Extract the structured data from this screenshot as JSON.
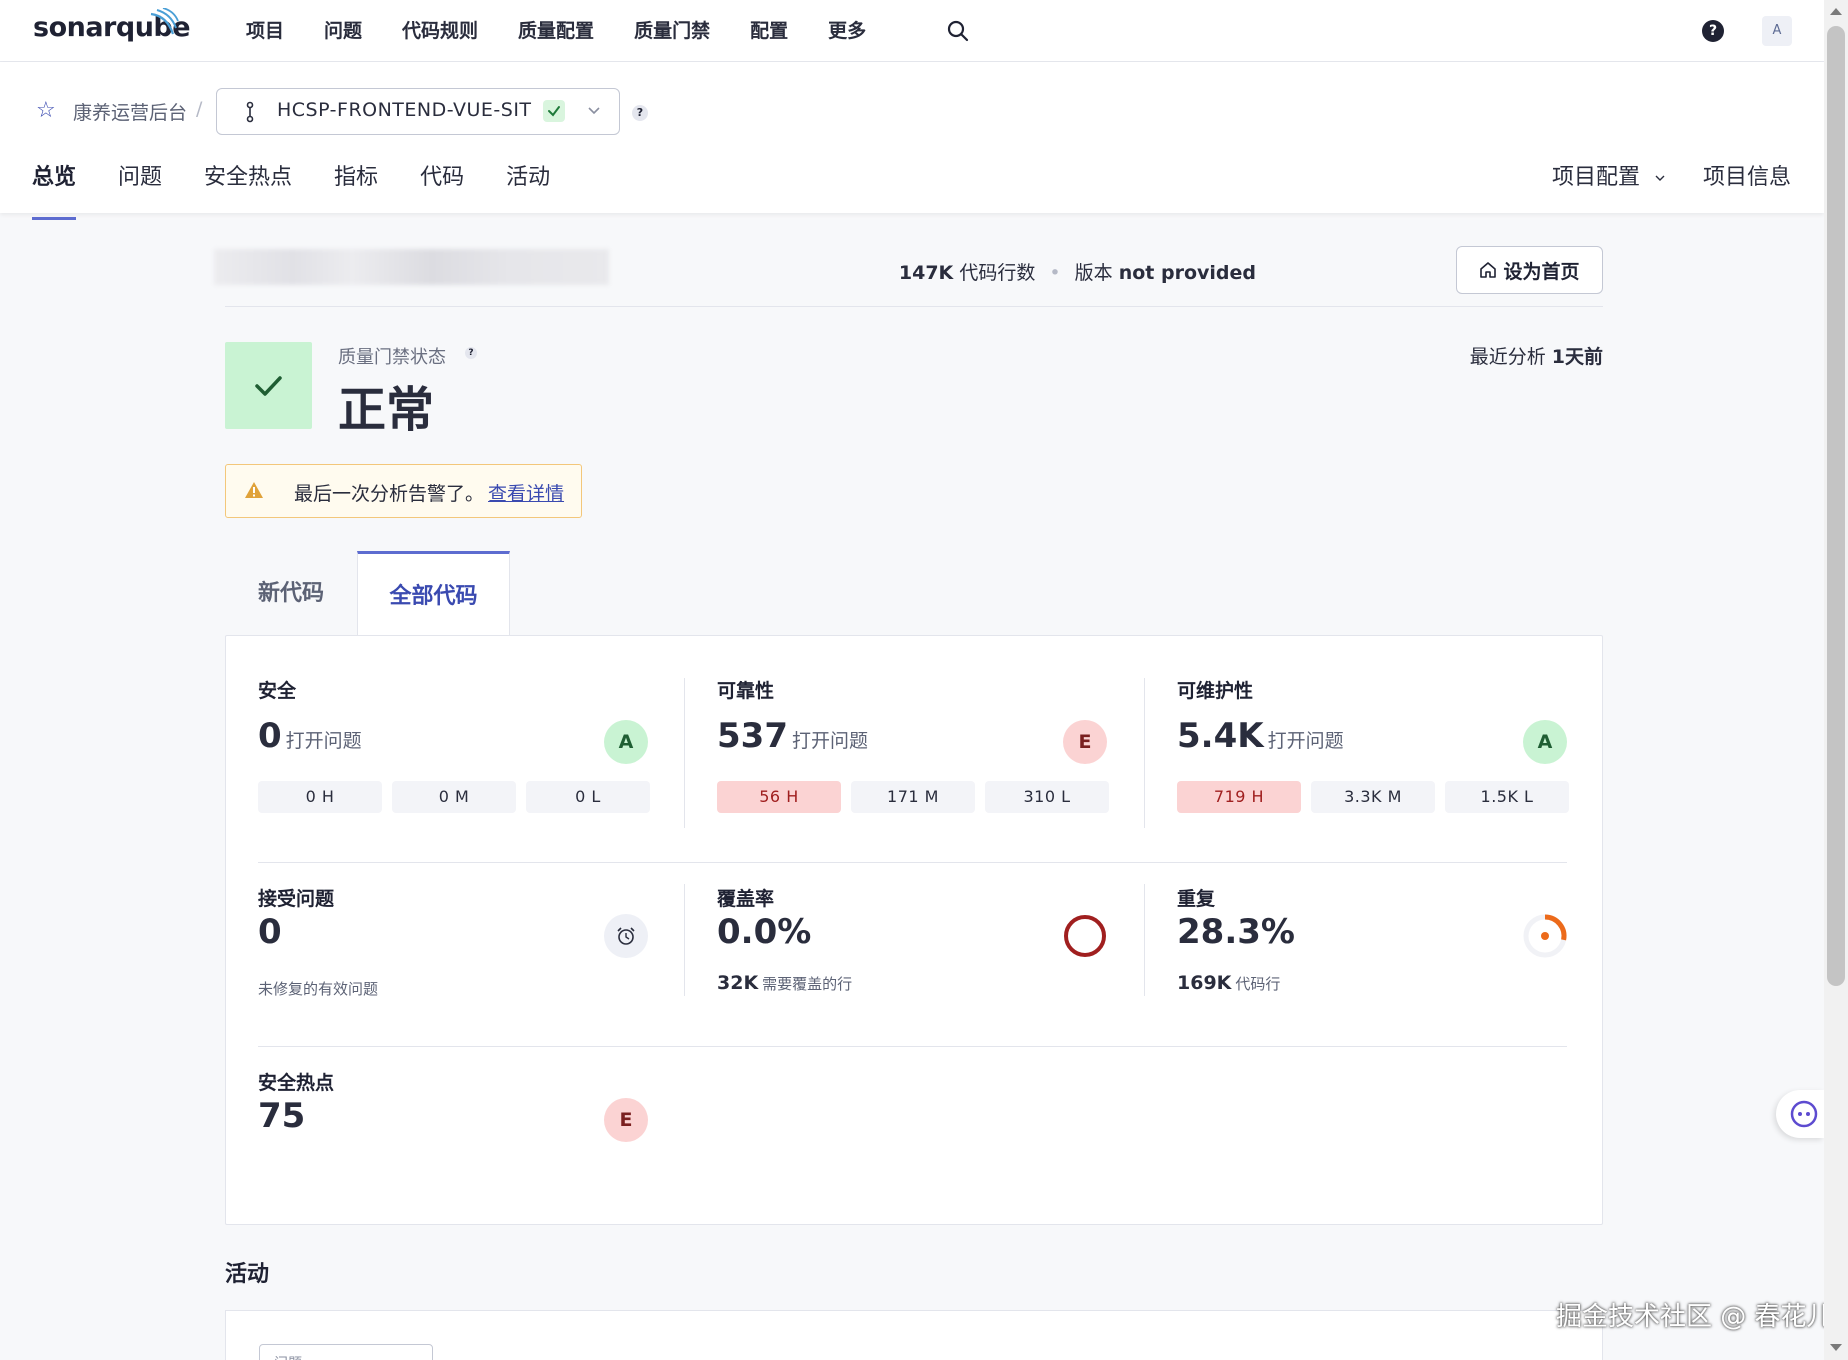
{
  "topnav": {
    "logo": "sonarqube",
    "items": [
      "项目",
      "问题",
      "代码规则",
      "质量配置",
      "质量门禁",
      "配置",
      "更多"
    ],
    "avatar": "A",
    "help": "?"
  },
  "project": {
    "org": "康养运营后台",
    "branch": "HCSP-FRONTEND-VUE-SIT",
    "tabs": [
      "总览",
      "问题",
      "安全热点",
      "指标",
      "代码",
      "活动"
    ],
    "right_tabs": {
      "config": "项目配置",
      "info": "项目信息"
    }
  },
  "meta": {
    "loc_value": "147K",
    "loc_label": "代码行数",
    "version_label": "版本",
    "version_value": "not provided",
    "home_button": "设为首页"
  },
  "quality_gate": {
    "label": "质量门禁状态",
    "status": "正常",
    "last_analysis_label": "最近分析",
    "last_analysis_value": "1天前"
  },
  "warning": {
    "text": "最后一次分析告警了。",
    "link": "查看详情"
  },
  "code_tabs": {
    "new": "新代码",
    "all": "全部代码"
  },
  "metrics": {
    "security": {
      "title": "安全",
      "value": "0",
      "unit": "打开问题",
      "rating": "A",
      "sev": [
        "0 H",
        "0 M",
        "0 L"
      ]
    },
    "reliability": {
      "title": "可靠性",
      "value": "537",
      "unit": "打开问题",
      "rating": "E",
      "sev": [
        "56 H",
        "171 M",
        "310 L"
      ]
    },
    "maintainability": {
      "title": "可维护性",
      "value": "5.4K",
      "unit": "打开问题",
      "rating": "A",
      "sev": [
        "719 H",
        "3.3K M",
        "1.5K L"
      ]
    },
    "accepted": {
      "title": "接受问题",
      "value": "0",
      "sub": "未修复的有效问题"
    },
    "coverage": {
      "title": "覆盖率",
      "value": "0.0%",
      "sub_value": "32K",
      "sub_label": "需要覆盖的行",
      "percent": 0.0
    },
    "duplication": {
      "title": "重复",
      "value": "28.3%",
      "sub_value": "169K",
      "sub_label": "代码行",
      "percent": 28.3
    },
    "hotspots": {
      "title": "安全热点",
      "value": "75",
      "rating": "E"
    }
  },
  "activity": {
    "title": "活动",
    "select_placeholder": "问题"
  },
  "colors": {
    "accent": "#5d6cd0",
    "pass": "#c9f3d3",
    "fail": "#fbd3d3",
    "brand_blue": "#3a4ab0"
  },
  "watermark": "掘金技术社区 @ 春花儿"
}
